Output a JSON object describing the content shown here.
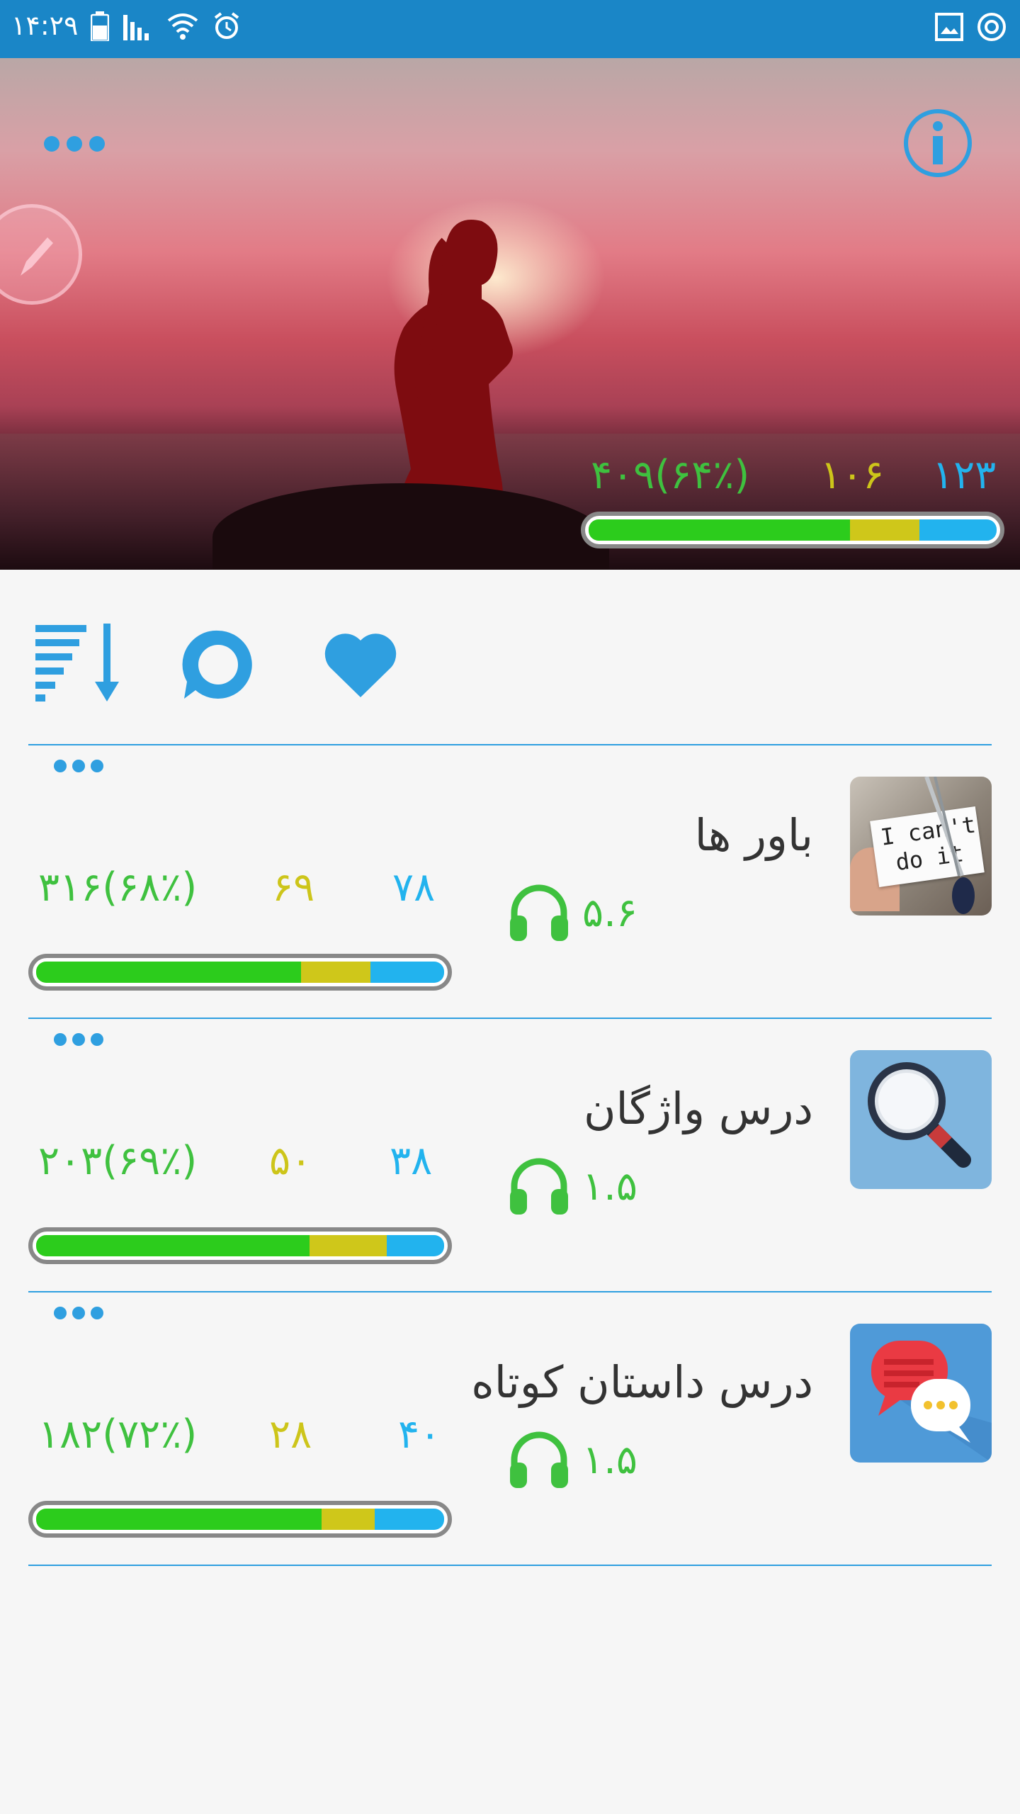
{
  "status_bar": {
    "time": "۱۴:۲۹"
  },
  "hero": {
    "stats": {
      "total": "۴۰۹(۶۴٪)",
      "middle": "۱۰۶",
      "right": "۱۲۳"
    },
    "progress": {
      "green": 0.64,
      "yellow": 0.17,
      "blue": 0.19
    }
  },
  "colors": {
    "accent": "#2f9fe0",
    "status_bar": "#1a86c7",
    "green": "#3fc13f",
    "yellow": "#cdc51a",
    "bar_green": "#2ccc1c",
    "bar_yellow": "#cfc71a",
    "bar_blue": "#22b3ee"
  },
  "lessons": [
    {
      "title": "باور ها",
      "thumb_text_line1": "I can't",
      "thumb_text_line2": "do it",
      "stats": {
        "total": "۳۱۶(۶۸٪)",
        "middle": "۶۹",
        "right": "۷۸"
      },
      "listen": "۵.۶",
      "progress": {
        "green": 0.65,
        "yellow": 0.17,
        "blue": 0.18
      }
    },
    {
      "title": "درس واژگان",
      "stats": {
        "total": "۲۰۳(۶۹٪)",
        "middle": "۵۰",
        "right": "۳۸"
      },
      "listen": "۱.۵",
      "progress": {
        "green": 0.67,
        "yellow": 0.19,
        "blue": 0.14
      }
    },
    {
      "title": "درس داستان کوتاه",
      "stats": {
        "total": "۱۸۲(۷۲٪)",
        "middle": "۲۸",
        "right": "۴۰"
      },
      "listen": "۱.۵",
      "progress": {
        "green": 0.7,
        "yellow": 0.13,
        "blue": 0.17
      }
    }
  ]
}
